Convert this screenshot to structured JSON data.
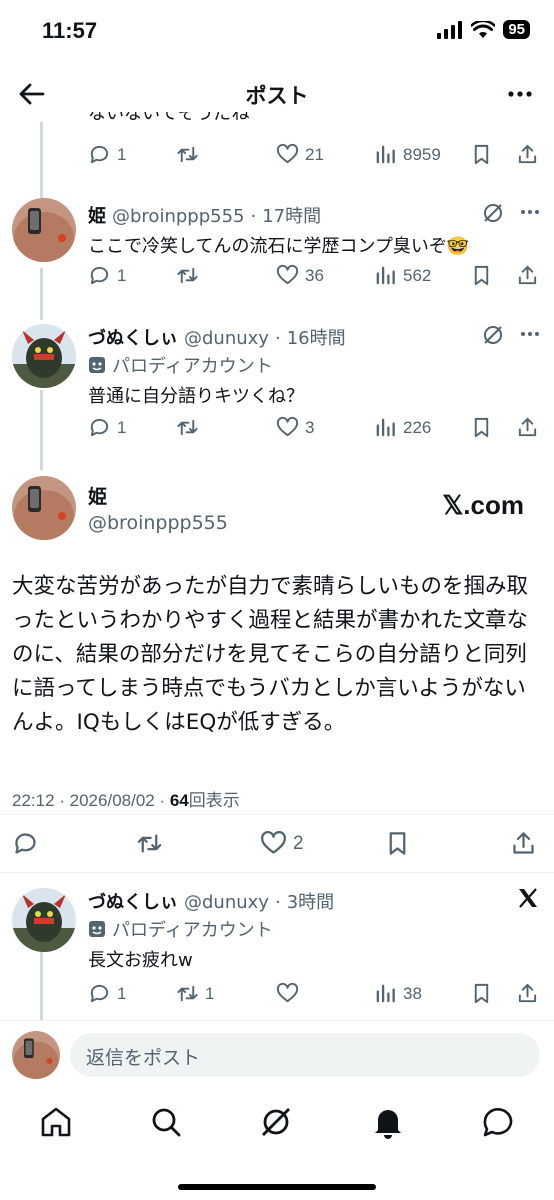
{
  "status": {
    "time": "11:57",
    "battery": "95"
  },
  "header": {
    "title": "ポスト"
  },
  "prev_reply": {
    "clipped_text": "ないないでそうだね",
    "replies": "1",
    "reposts": "",
    "likes": "21",
    "views": "8959"
  },
  "replies": [
    {
      "name": "姫",
      "handle": "@broinppp555",
      "time": "17時間",
      "text": "ここで冷笑してんの流石に学歴コンプ臭いぞ🤓",
      "replies": "1",
      "reposts": "",
      "likes": "36",
      "views": "562"
    },
    {
      "name": "づぬくしぃ",
      "handle": "@dunuxy",
      "time": "16時間",
      "parody": "パロディアカウント",
      "text": "普通に自分語りキツくね？",
      "replies": "1",
      "reposts": "",
      "likes": "3",
      "views": "226"
    }
  ],
  "main_post": {
    "name": "姫",
    "handle": "@broinppp555",
    "watermark": "𝕏.com",
    "text": "大変な苦労があったが自力で素晴らしいものを掴み取ったというわかりやすく過程と結果が書かれた文章なのに、結果の部分だけを見てそこらの自分語りと同列に語ってしまう時点でもうバカとしか言いようがないんよ。IQもしくはEQが低すぎる。",
    "timestamp": "22:12 · 2026/08/02 · ",
    "views_count": "64",
    "views_label": "回表示",
    "likes": "2"
  },
  "last_reply": {
    "name": "づぬくしぃ",
    "handle": "@dunuxy",
    "time": "3時間",
    "parody": "パロディアカウント",
    "text": "長文お疲れw",
    "replies": "1",
    "reposts": "1",
    "likes": "",
    "views": "38"
  },
  "reply_bar": {
    "placeholder": "返信をポスト"
  },
  "colors": {
    "text": "#0f1419",
    "muted": "#536471",
    "line": "#cfd9de"
  }
}
